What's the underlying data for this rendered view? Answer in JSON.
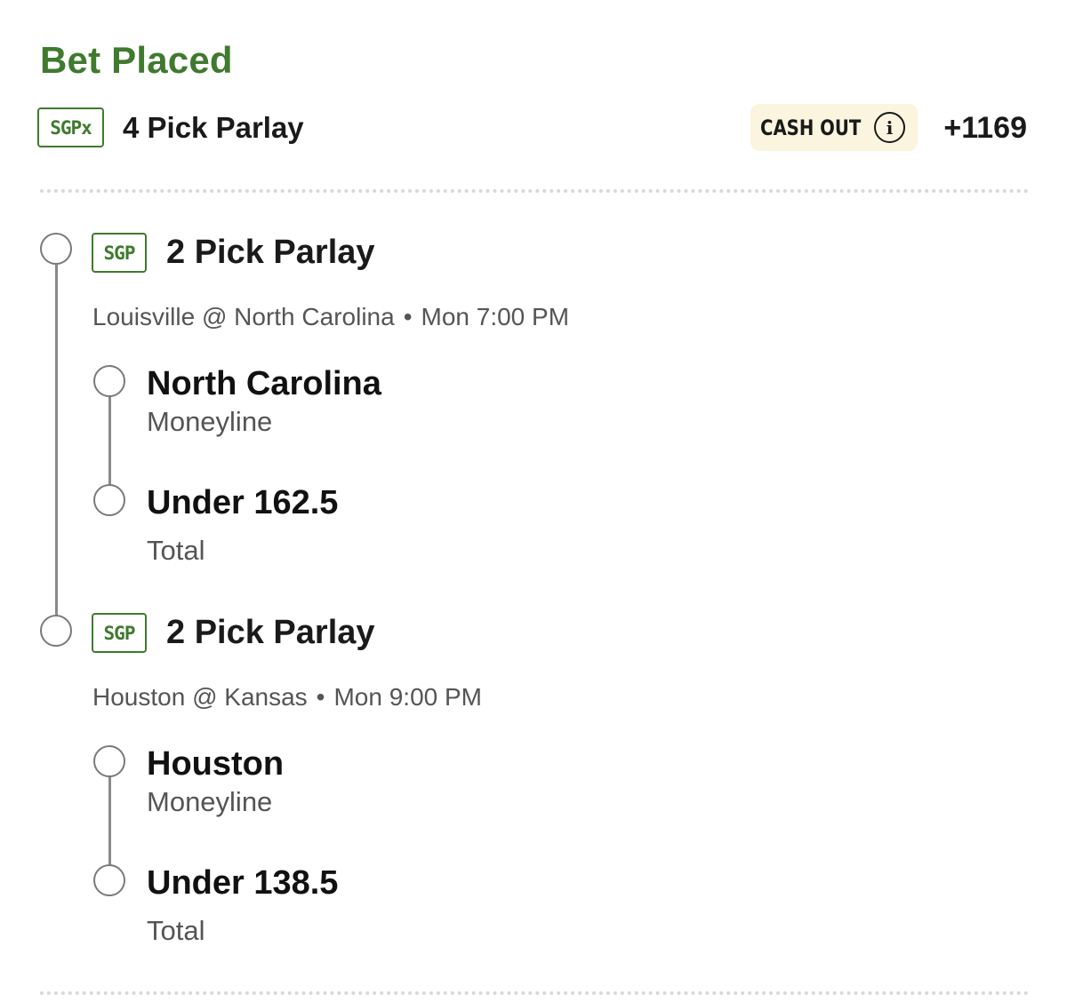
{
  "header": {
    "status": "Bet Placed",
    "badge": "SGPx",
    "parlay_title": "4 Pick Parlay",
    "cash_out_label": "CASH OUT",
    "odds": "+1169"
  },
  "legs": [
    {
      "badge": "SGP",
      "title": "2 Pick Parlay",
      "matchup": "Louisville @ North Carolina",
      "time": "Mon 7:00 PM",
      "picks": [
        {
          "name": "North Carolina",
          "market": "Moneyline"
        },
        {
          "name": "Under 162.5",
          "market": "Total"
        }
      ]
    },
    {
      "badge": "SGP",
      "title": "2 Pick Parlay",
      "matchup": "Houston @ Kansas",
      "time": "Mon 9:00 PM",
      "picks": [
        {
          "name": "Houston",
          "market": "Moneyline"
        },
        {
          "name": "Under 138.5",
          "market": "Total"
        }
      ]
    }
  ],
  "separator": "•",
  "colors": {
    "accent_green": "#3f7a2e",
    "cash_out_bg": "#fbf5df",
    "timeline_gray": "#7a7a7a"
  },
  "icons": {
    "cash_out_info": "info-circle-icon"
  }
}
